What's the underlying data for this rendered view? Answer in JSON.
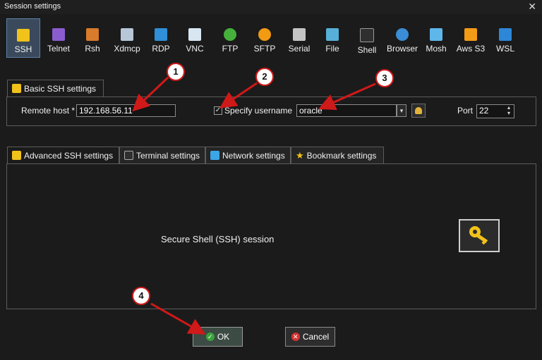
{
  "window": {
    "title": "Session settings",
    "close_symbol": "✕"
  },
  "toolbar": {
    "items": [
      {
        "label": "SSH",
        "icon": "ssh-key-icon",
        "color": "#f0c21a"
      },
      {
        "label": "Telnet",
        "icon": "telnet-icon",
        "color": "#8a5ccf"
      },
      {
        "label": "Rsh",
        "icon": "rsh-icon",
        "color": "#d87b2a"
      },
      {
        "label": "Xdmcp",
        "icon": "xdmcp-icon",
        "color": "#b7c7d8"
      },
      {
        "label": "RDP",
        "icon": "rdp-icon",
        "color": "#2f8fd8"
      },
      {
        "label": "VNC",
        "icon": "vnc-icon",
        "color": "#d8e6f2"
      },
      {
        "label": "FTP",
        "icon": "ftp-icon",
        "color": "#45b13b"
      },
      {
        "label": "SFTP",
        "icon": "sftp-icon",
        "color": "#f29a12"
      },
      {
        "label": "Serial",
        "icon": "serial-icon",
        "color": "#c4c4c4"
      },
      {
        "label": "File",
        "icon": "file-icon",
        "color": "#56b0d8"
      },
      {
        "label": "Shell",
        "icon": "shell-icon",
        "color": "#2f2f2f"
      },
      {
        "label": "Browser",
        "icon": "browser-icon",
        "color": "#3a8dd6"
      },
      {
        "label": "Mosh",
        "icon": "mosh-icon",
        "color": "#5fb6ea"
      },
      {
        "label": "Aws S3",
        "icon": "aws-s3-icon",
        "color": "#f39b17"
      },
      {
        "label": "WSL",
        "icon": "wsl-icon",
        "color": "#2e86d7"
      }
    ]
  },
  "basic": {
    "tab_label": "Basic SSH settings",
    "remote_host_label": "Remote host *",
    "remote_host_value": "192.168.56.11",
    "specify_username_label": "Specify username",
    "specify_username_checked": "✓",
    "username_value": "oracle",
    "port_label": "Port",
    "port_value": "22"
  },
  "subtabs": [
    {
      "label": "Advanced SSH settings",
      "icon": "key-icon"
    },
    {
      "label": "Terminal settings",
      "icon": "terminal-icon"
    },
    {
      "label": "Network settings",
      "icon": "network-icon"
    },
    {
      "label": "Bookmark settings",
      "icon": "star-icon"
    }
  ],
  "main": {
    "description": "Secure Shell (SSH) session"
  },
  "buttons": {
    "ok_label": "OK",
    "cancel_label": "Cancel"
  },
  "annotations": {
    "badges": [
      "1",
      "2",
      "3",
      "4"
    ]
  },
  "colors": {
    "annotation_red": "#d01919",
    "selected_tool": "#3a4a5c"
  }
}
